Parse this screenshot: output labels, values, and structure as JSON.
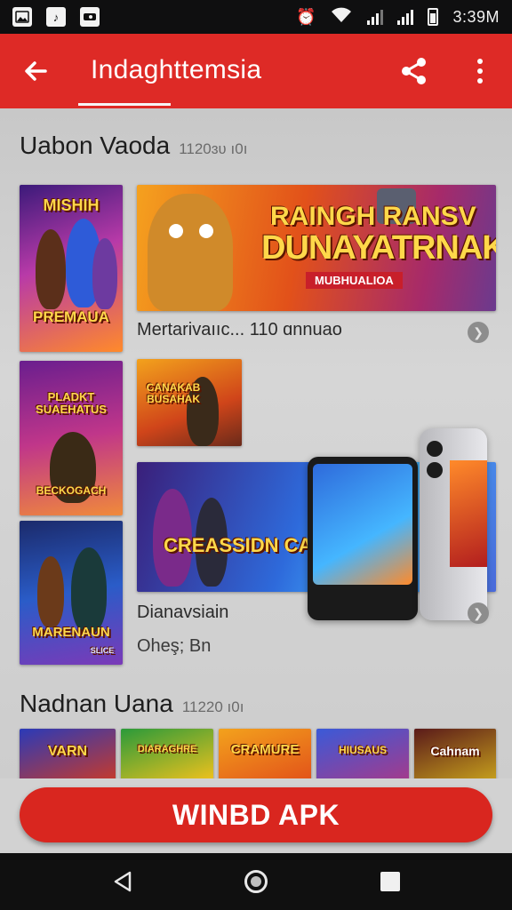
{
  "status_bar": {
    "time": "3:39M",
    "left_icons": [
      "gallery-icon",
      "music-icon",
      "messages-icon"
    ],
    "right_icons": [
      "alarm-icon",
      "wifi-icon",
      "signal-icon",
      "signal-icon",
      "battery-icon"
    ]
  },
  "app_bar": {
    "title": "Indaghttemsia",
    "background": "#de2a26",
    "icons": [
      "back-arrow-icon",
      "share-icon",
      "more-vert-icon"
    ]
  },
  "section1": {
    "title": "Uabon Vaoda",
    "count": "1120ɜʋ ı0ı",
    "posters": [
      {
        "text": "MISHIH",
        "subtext": "PREMAUA"
      },
      {
        "text": "PLADKT SUAEHATUS",
        "subtext": "BECKOGACH"
      },
      {
        "text": "MARENAUN",
        "subtext": "SLICE"
      }
    ],
    "featured": {
      "headline_1": "RAINGH RANSV",
      "headline_2": "DUNAYATRNAKS",
      "ribbon": "MUBHUALIOA",
      "caption": "Mertarivaııc... 110 ɑnnuao"
    },
    "small_tile": {
      "text": "CANAKAB BUSAHAK"
    },
    "promo": {
      "banner_text": "CREASSIDN CALEHHNSS",
      "caption": "Dianavsiain",
      "subcaption": "Oheş; Bn"
    }
  },
  "section2": {
    "title": "Nadnan Uana",
    "count": "11220 ı0ı",
    "tiles": [
      "VARN",
      "DIARAGHRE",
      "CRAMURE",
      "HIUSAUS",
      "Cahnam"
    ]
  },
  "cta": {
    "label": "WINBD APK",
    "color": "#d9261f"
  },
  "nav_bar": {
    "icons": [
      "nav-back-icon",
      "nav-home-icon",
      "nav-recents-icon"
    ]
  }
}
